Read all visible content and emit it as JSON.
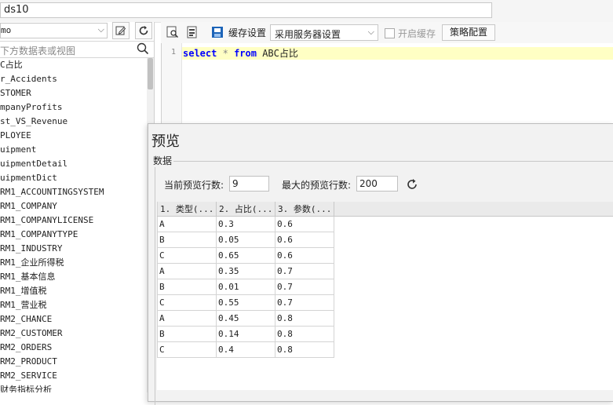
{
  "top": {
    "name_value": "ds10"
  },
  "left": {
    "db_value": "mo",
    "search_placeholder": "下方数据表或视图",
    "tables": [
      "C占比",
      "r_Accidents",
      "STOMER",
      "mpanyProfits",
      "st_VS_Revenue",
      "PLOYEE",
      "uipment",
      "uipmentDetail",
      "uipmentDict",
      "RM1_ACCOUNTINGSYSTEM",
      "RM1_COMPANY",
      "RM1_COMPANYLICENSE",
      "RM1_COMPANYTYPE",
      "RM1_INDUSTRY",
      "RM1_企业所得税",
      "RM1_基本信息",
      "RM1_增值税",
      "RM1_营业税",
      "RM2_CHANCE",
      "RM2_CUSTOMER",
      "RM2_ORDERS",
      "RM2_PRODUCT",
      "RM2_SERVICE",
      "财务指标分析"
    ]
  },
  "toolbar": {
    "cache_label": "缓存设置",
    "cache_select": "采用服务器设置",
    "enable_cache": "开启缓存",
    "strategy_button": "策略配置"
  },
  "editor": {
    "line_number": "1",
    "kw_select": "select",
    "star": "*",
    "kw_from": "from",
    "table_name": "ABC占比"
  },
  "preview": {
    "title": "预览",
    "group_label": "数据",
    "current_rows_label": "当前预览行数:",
    "current_rows_value": "9",
    "max_rows_label": "最大的预览行数:",
    "max_rows_value": "200",
    "columns": [
      "1. 类型(...",
      "2. 占比(...",
      "3. 参数(..."
    ],
    "rows": [
      [
        "A",
        "0.3",
        "0.6"
      ],
      [
        "B",
        "0.05",
        "0.6"
      ],
      [
        "C",
        "0.65",
        "0.6"
      ],
      [
        "A",
        "0.35",
        "0.7"
      ],
      [
        "B",
        "0.01",
        "0.7"
      ],
      [
        "C",
        "0.55",
        "0.7"
      ],
      [
        "A",
        "0.45",
        "0.8"
      ],
      [
        "B",
        "0.14",
        "0.8"
      ],
      [
        "C",
        "0.4",
        "0.8"
      ]
    ]
  },
  "colors": {
    "keyword": "#0000ff",
    "line_highlight": "#ffffc4",
    "dialog_bg": "#f2f2f2"
  },
  "icons": [
    "preview-icon",
    "sql-icon",
    "cache-icon",
    "search-icon",
    "refresh-icon",
    "edit-icon",
    "chevron-down-icon"
  ]
}
